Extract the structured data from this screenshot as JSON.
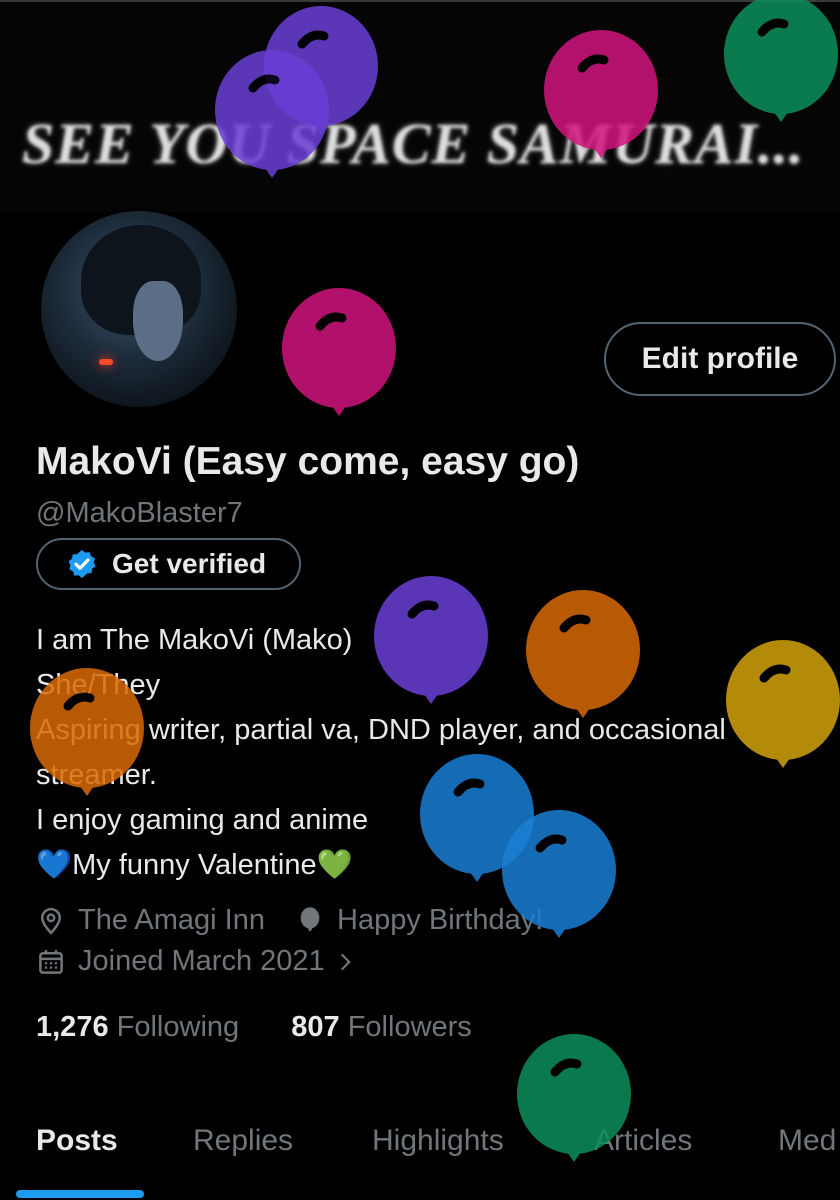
{
  "banner": {
    "text": "SEE YOU SPACE SAMURAI..."
  },
  "profile": {
    "edit_label": "Edit profile",
    "display_name": "MakoVi (Easy come, easy go)",
    "handle": "@MakoBlaster7",
    "verify_label": "Get verified",
    "bio": [
      "I am The MakoVi (Mako)",
      "She/They",
      "Aspiring writer, partial va, DND player, and occasional",
      "streamer.",
      "I enjoy gaming and anime",
      "💙My funny Valentine💚"
    ],
    "location": "The Amagi Inn",
    "birthday": "Happy Birthday!",
    "joined": "Joined March 2021",
    "following_count": "1,276",
    "following_label": "Following",
    "followers_count": "807",
    "followers_label": "Followers"
  },
  "tabs": [
    {
      "label": "Posts",
      "active": true
    },
    {
      "label": "Replies"
    },
    {
      "label": "Highlights"
    },
    {
      "label": "Articles"
    },
    {
      "label": "Med"
    }
  ],
  "icons": {
    "verified": "verified-badge-icon",
    "location": "location-pin-icon",
    "birthday": "balloon-icon",
    "joined": "calendar-icon",
    "chevron": "chevron-right-icon"
  },
  "colors": {
    "accent": "#1d9bf0",
    "balloon_purple": "#6a3fd6",
    "balloon_pink": "#d1147e",
    "balloon_green": "#0c8f5c",
    "balloon_orange": "#d96a05",
    "balloon_yellow": "#d4a40a",
    "balloon_blue": "#1a7fd4"
  }
}
